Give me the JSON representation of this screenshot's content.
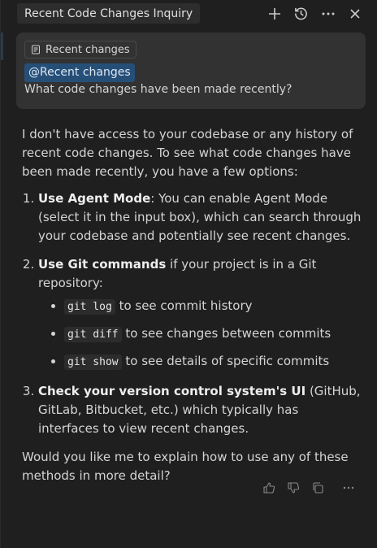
{
  "header": {
    "title": "Recent Code Changes Inquiry",
    "actions": [
      {
        "name": "new-chat-button",
        "icon": "plus-icon"
      },
      {
        "name": "history-button",
        "icon": "history-icon"
      },
      {
        "name": "more-button",
        "icon": "ellipsis-icon"
      },
      {
        "name": "close-button",
        "icon": "close-icon"
      }
    ]
  },
  "query": {
    "chip_label": "Recent changes",
    "chip_icon": "context-icon",
    "mention": "@Recent changes",
    "text": "What code changes have been made recently?"
  },
  "response": {
    "intro": "I don't have access to your codebase or any history of recent code changes. To see what code changes have been made recently, you have a few options:",
    "items": [
      {
        "bold": "Use Agent Mode",
        "text": ": You can enable Agent Mode (select it in the input box), which can search through your codebase and potentially see recent changes."
      },
      {
        "bold": "Use Git commands",
        "text": " if your project is in a Git repository:",
        "subitems": [
          {
            "code": "git log",
            "text": " to see commit history"
          },
          {
            "code": "git diff",
            "text": " to see changes between commits"
          },
          {
            "code": "git show",
            "text": " to see details of specific commits"
          }
        ]
      },
      {
        "bold": "Check your version control system's UI",
        "text": " (GitHub, GitLab, Bitbucket, etc.) which typically has interfaces to view recent changes."
      }
    ],
    "closing": "Would you like me to explain how to use any of these methods in more detail?"
  },
  "feedback": {
    "icons": [
      "thumbs-up-icon",
      "thumbs-down-icon",
      "copy-icon",
      "ellipsis-icon"
    ]
  },
  "colors": {
    "background": "#1f1f1f",
    "card": "#323232",
    "mention_bg": "#264f78",
    "text": "#d4d4d4"
  }
}
